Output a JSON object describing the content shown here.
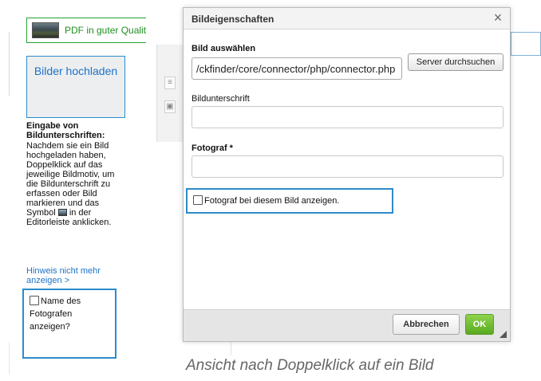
{
  "sidebar": {
    "pdf_link": "PDF in guter Qualitä",
    "upload_button": "Bilder hochladen",
    "help_title": "Eingabe von Bildunterschriften:",
    "help_text_before_icon": "Nachdem sie ein Bild hochgeladen haben, Doppelklick auf das jeweilige Bildmotiv, um die Bildunterschrift zu erfassen oder Bild markieren und das Symbol",
    "help_text_after_icon": "in der Editorleiste anklicken.",
    "hint_link": "Hinweis nicht mehr anzeigen >",
    "name_checkbox_label": "Name des Fotografen anzeigen?",
    "icon": "image-icon"
  },
  "dialog": {
    "title": "Bildeigenschaften",
    "close_icon": "×",
    "select_image_label": "Bild auswählen",
    "select_image_value": "/ckfinder/core/connector/php/connector.php",
    "browse_button": "Server durchsuchen",
    "caption_label": "Bildunterschrift",
    "caption_value": "",
    "photographer_label": "Fotograf *",
    "photographer_value": "",
    "show_photographer_label": "Fotograf bei diesem Bild anzeigen.",
    "cancel_button": "Abbrechen",
    "ok_button": "OK"
  },
  "figure_caption": "Ansicht nach Doppelklick auf ein Bild",
  "colors": {
    "accent_blue": "#2d8bcb",
    "link_blue": "#1c73c8",
    "pdf_green": "#1f8f1f",
    "ok_green": "#59aa1f"
  }
}
